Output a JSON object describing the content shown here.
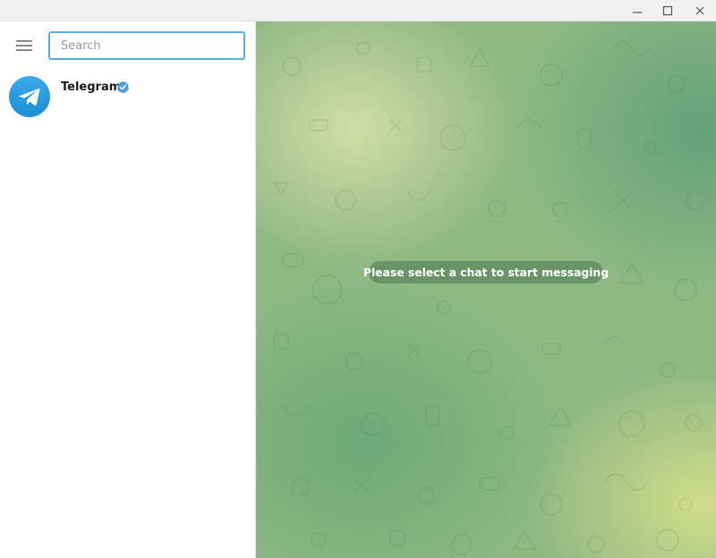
{
  "window": {
    "controls": [
      {
        "name": "minimize",
        "icon": "minimize-icon"
      },
      {
        "name": "maximize",
        "icon": "maximize-icon"
      },
      {
        "name": "close",
        "icon": "close-icon"
      }
    ]
  },
  "sidebar": {
    "menu_icon": "hamburger-menu-icon",
    "search": {
      "placeholder": "Search",
      "value": ""
    },
    "chats": [
      {
        "name": "Telegram",
        "verified": true,
        "avatar_icon": "telegram-paper-plane-icon",
        "avatar_color": "#2ea6e6"
      }
    ]
  },
  "chat_area": {
    "empty_message": "Please select a chat to start messaging",
    "colors": {
      "accent": "#5ab1e0",
      "verified": "#4a9fe0"
    }
  }
}
